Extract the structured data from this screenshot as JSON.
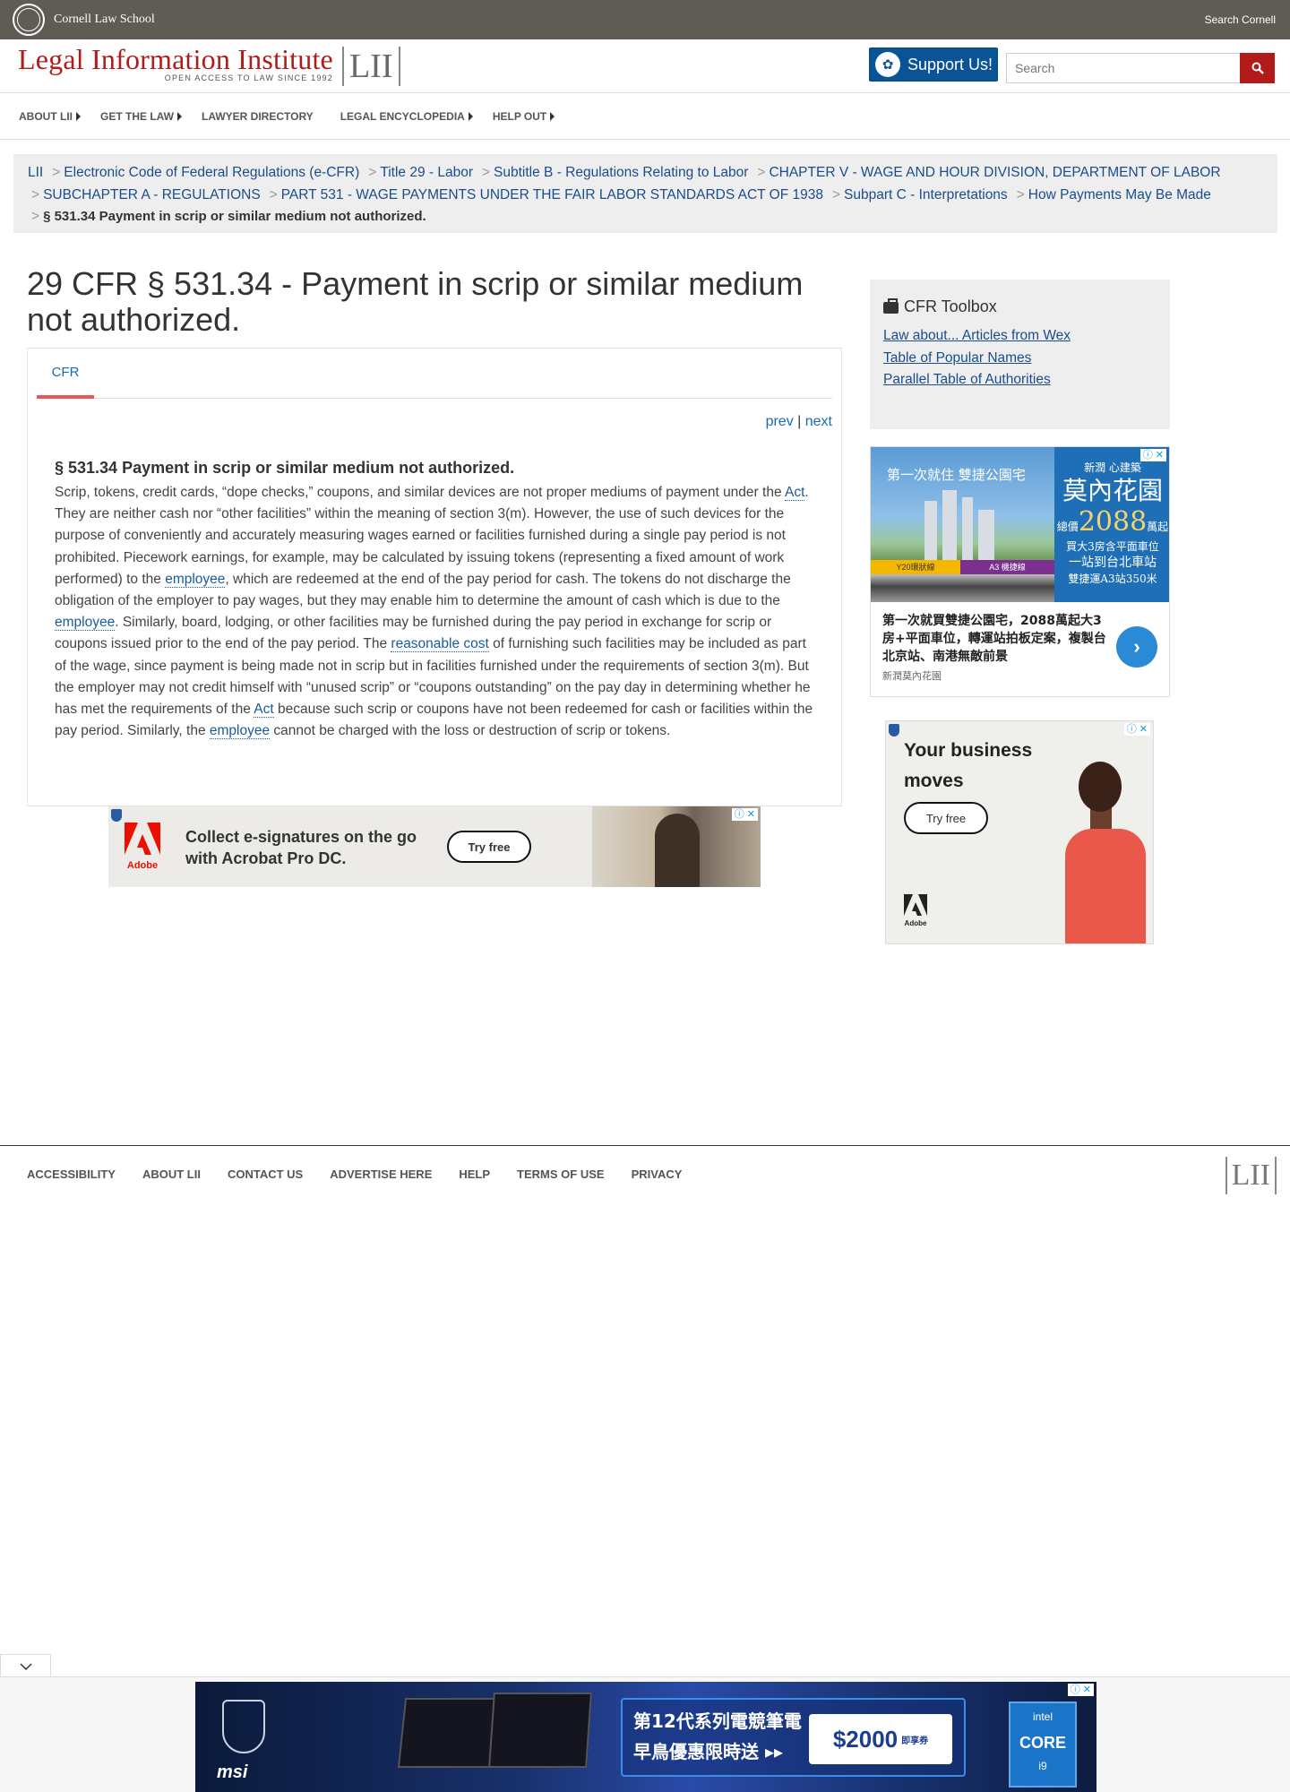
{
  "topbar": {
    "school": "Cornell Law School",
    "search_link": "Search Cornell"
  },
  "header": {
    "logo_title": "Legal Information Institute",
    "logo_tagline": "OPEN ACCESS TO LAW SINCE 1992",
    "logo_mark": "LII",
    "support_label": "Support Us!",
    "search_placeholder": "Search"
  },
  "nav": {
    "items": [
      {
        "label": "ABOUT LII",
        "has_menu": true
      },
      {
        "label": "GET THE LAW",
        "has_menu": true
      },
      {
        "label": "LAWYER DIRECTORY",
        "has_menu": false
      },
      {
        "label": "LEGAL ENCYCLOPEDIA",
        "has_menu": true
      },
      {
        "label": "HELP OUT",
        "has_menu": true
      }
    ]
  },
  "breadcrumb": {
    "separator": ">",
    "items": [
      "LII",
      "Electronic Code of Federal Regulations (e-CFR)",
      "Title 29 - Labor",
      "Subtitle B - Regulations Relating to Labor",
      "CHAPTER V - WAGE AND HOUR DIVISION, DEPARTMENT OF LABOR",
      "SUBCHAPTER A - REGULATIONS",
      "PART 531 - WAGE PAYMENTS UNDER THE FAIR LABOR STANDARDS ACT OF 1938",
      "Subpart C - Interpretations",
      "How Payments May Be Made"
    ],
    "current": "§ 531.34 Payment in scrip or similar medium not authorized."
  },
  "page_title": "29 CFR § 531.34 - Payment in scrip or similar medium not authorized.",
  "tabs": [
    {
      "label": "CFR",
      "active": true
    }
  ],
  "pager": {
    "prev": "prev",
    "divider": "|",
    "next": "next"
  },
  "section": {
    "title": "§ 531.34 Payment in scrip or similar medium not authorized.",
    "body_parts": [
      {
        "text": "Scrip, tokens, credit cards, “dope checks,” coupons, and similar devices are not proper mediums of payment under the ",
        "link": false
      },
      {
        "text": "Act",
        "link": true
      },
      {
        "text": ". They are neither cash nor “other facilities” within the meaning of section 3(m). However, the use of such devices for the purpose of conveniently and accurately measuring wages earned or facilities furnished during a single pay period is not prohibited. Piecework earnings, for example, may be calculated by issuing tokens (representing a fixed amount of work performed) to the ",
        "link": false
      },
      {
        "text": "employee",
        "link": true
      },
      {
        "text": ", which are redeemed at the end of the pay period for cash. The tokens do not discharge the obligation of the employer to pay wages, but they may enable him to determine the amount of cash which is due to the ",
        "link": false
      },
      {
        "text": "employee",
        "link": true
      },
      {
        "text": ". Similarly, board, lodging, or other facilities may be furnished during the pay period in exchange for scrip or coupons issued prior to the end of the pay period. The ",
        "link": false
      },
      {
        "text": "reasonable cost",
        "link": true
      },
      {
        "text": " of furnishing such facilities may be included as part of the wage, since payment is being made not in scrip but in facilities furnished under the requirements of section 3(m). But the employer may not credit himself with “unused scrip” or “coupons outstanding” on the pay day in determining whether he has met the requirements of the ",
        "link": false
      },
      {
        "text": "Act",
        "link": true
      },
      {
        "text": " because such scrip or coupons have not been redeemed for cash or facilities within the pay period. Similarly, the ",
        "link": false
      },
      {
        "text": "employee",
        "link": true
      },
      {
        "text": " cannot be charged with the loss or destruction of scrip or tokens.",
        "link": false
      }
    ]
  },
  "toolbox": {
    "title": "CFR Toolbox",
    "icon": "briefcase-icon",
    "links": [
      "Law about... Articles from Wex",
      "Table of Popular Names",
      "Parallel Table of Authorities"
    ]
  },
  "ads": {
    "inline": {
      "logo": "Adobe",
      "headline_1": "Collect e-signatures on the go",
      "headline_2": "with Acrobat Pro DC.",
      "cta": "Try free"
    },
    "side_realestate": {
      "headline": "第一次就住 雙捷公園宅",
      "brand_top": "新潤 心建築",
      "brand_name": "莫內花園",
      "price_prefix": "總價",
      "price": "2088",
      "price_suffix": "萬起",
      "line1": "買大3房含平面車位",
      "line2": "一站到台北車站",
      "line3": "雙捷運A3站350米",
      "tag1": "Y20環狀線",
      "tag2": "A3 機捷線",
      "desc": "第一次就買雙捷公園宅，2088萬起大3房+平面車位，轉運站拍板定案，複製台北京站、南港無敵前景",
      "sponsor": "新潤莫內花園"
    },
    "side_adobe": {
      "headline_1": "Your business",
      "headline_2": "moves",
      "cta": "Try free",
      "logo": "Adobe"
    },
    "sticky": {
      "brand": "msi",
      "line1": "第12代系列電競筆電",
      "line2": "早鳥優惠限時送 ▸▸",
      "price": "$2000",
      "price_note": "即享券",
      "chip_brand": "intel",
      "chip_name": "CORE",
      "chip_tier": "i9"
    }
  },
  "footer": {
    "links": [
      "ACCESSIBILITY",
      "ABOUT LII",
      "CONTACT US",
      "ADVERTISE HERE",
      "HELP",
      "TERMS OF USE",
      "PRIVACY"
    ],
    "logo_mark": "LII"
  },
  "colors": {
    "topbar": "#5f5c55",
    "brand_red": "#b31b1b",
    "support_blue": "#0a5394",
    "link": "#1a4d8c",
    "tab_underline": "#e85a5a"
  }
}
